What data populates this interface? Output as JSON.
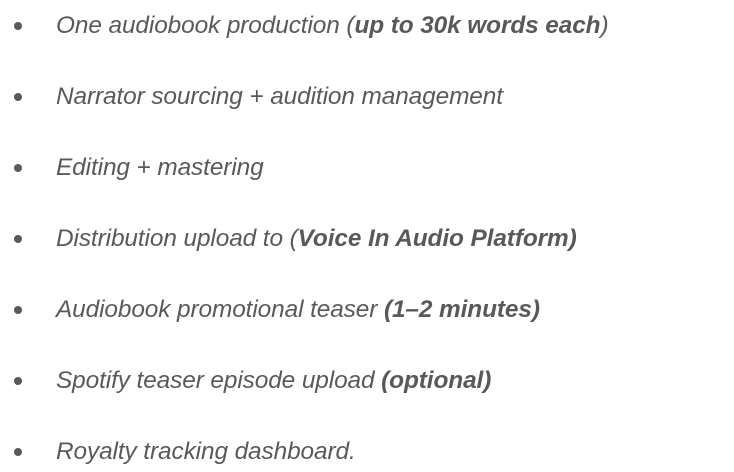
{
  "list": {
    "bullet_color": "#595959",
    "text_color": "#595959",
    "items": [
      {
        "pre": "One audiobook production  (",
        "bold": "up to 30k words each",
        "post": ")"
      },
      {
        "pre": "Narrator sourcing + audition management",
        "bold": "",
        "post": ""
      },
      {
        "pre": "Editing + mastering",
        "bold": "",
        "post": ""
      },
      {
        "pre": "Distribution upload to (",
        "bold": "Voice In Audio Platform)",
        "post": ""
      },
      {
        "pre": "Audiobook promotional teaser ",
        "bold": "(1–2 minutes)",
        "post": ""
      },
      {
        "pre": "Spotify teaser episode upload ",
        "bold": "(optional)",
        "post": ""
      },
      {
        "pre": "Royalty tracking dashboard.",
        "bold": "",
        "post": ""
      }
    ]
  }
}
